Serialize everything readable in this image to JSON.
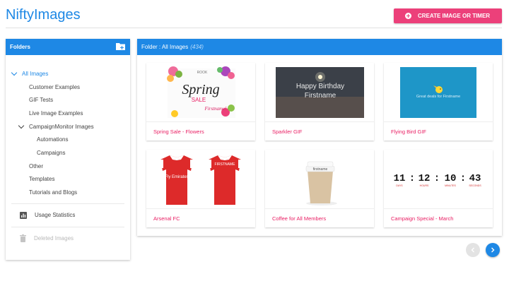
{
  "app": {
    "title": "NiftyImages"
  },
  "header": {
    "create_button_label": "CREATE IMAGE OR TIMER"
  },
  "sidebar": {
    "title": "Folders",
    "tree": [
      {
        "label": "All Images",
        "level": 0,
        "expanded": true,
        "selected": true
      },
      {
        "label": "Customer Examples",
        "level": 1
      },
      {
        "label": "GIF Tests",
        "level": 1
      },
      {
        "label": "Live Image Examples",
        "level": 1
      },
      {
        "label": "CampaignMonitor Images",
        "level": 1,
        "expanded": true
      },
      {
        "label": "Automations",
        "level": 2
      },
      {
        "label": "Campaigns",
        "level": 2
      },
      {
        "label": "Other",
        "level": 1
      },
      {
        "label": "Templates",
        "level": 1
      },
      {
        "label": "Tutorials and Blogs",
        "level": 1
      }
    ],
    "usage_label": "Usage Statistics",
    "deleted_label": "Deleted Images",
    "deleted_disabled": true
  },
  "main": {
    "header_prefix": "Folder : All Images",
    "header_count": "(434)",
    "cards": [
      {
        "title": "Spring Sale - Flowers",
        "thumb_text": [
          "Spring",
          "SALE",
          "Firstname!",
          "ROOK"
        ]
      },
      {
        "title": "Sparkler GIF",
        "thumb_text": [
          "Happy Birthday",
          "Firstname"
        ]
      },
      {
        "title": "Flying Bird GIF",
        "thumb_text": [
          "Great deals for Firstname"
        ]
      },
      {
        "title": "Arsenal FC",
        "thumb_text": [
          "Fly Emirates",
          "FIRSTNAME"
        ]
      },
      {
        "title": "Coffee for All Members",
        "thumb_text": [
          "firstname"
        ]
      },
      {
        "title": "Campaign Special - March",
        "thumb_text": [
          "11",
          "12",
          "10",
          "43",
          "DAYS",
          "HOURS",
          "MINUTES",
          "SECONDS"
        ]
      }
    ]
  },
  "colors": {
    "accent": "#1e88e5",
    "pink": "#ec407a",
    "card_title": "#e91e63"
  },
  "icons": [
    "new-folder-icon",
    "bar-chart-icon",
    "trash-icon",
    "chevron-left-icon",
    "chevron-right-icon",
    "add-circle-icon"
  ]
}
